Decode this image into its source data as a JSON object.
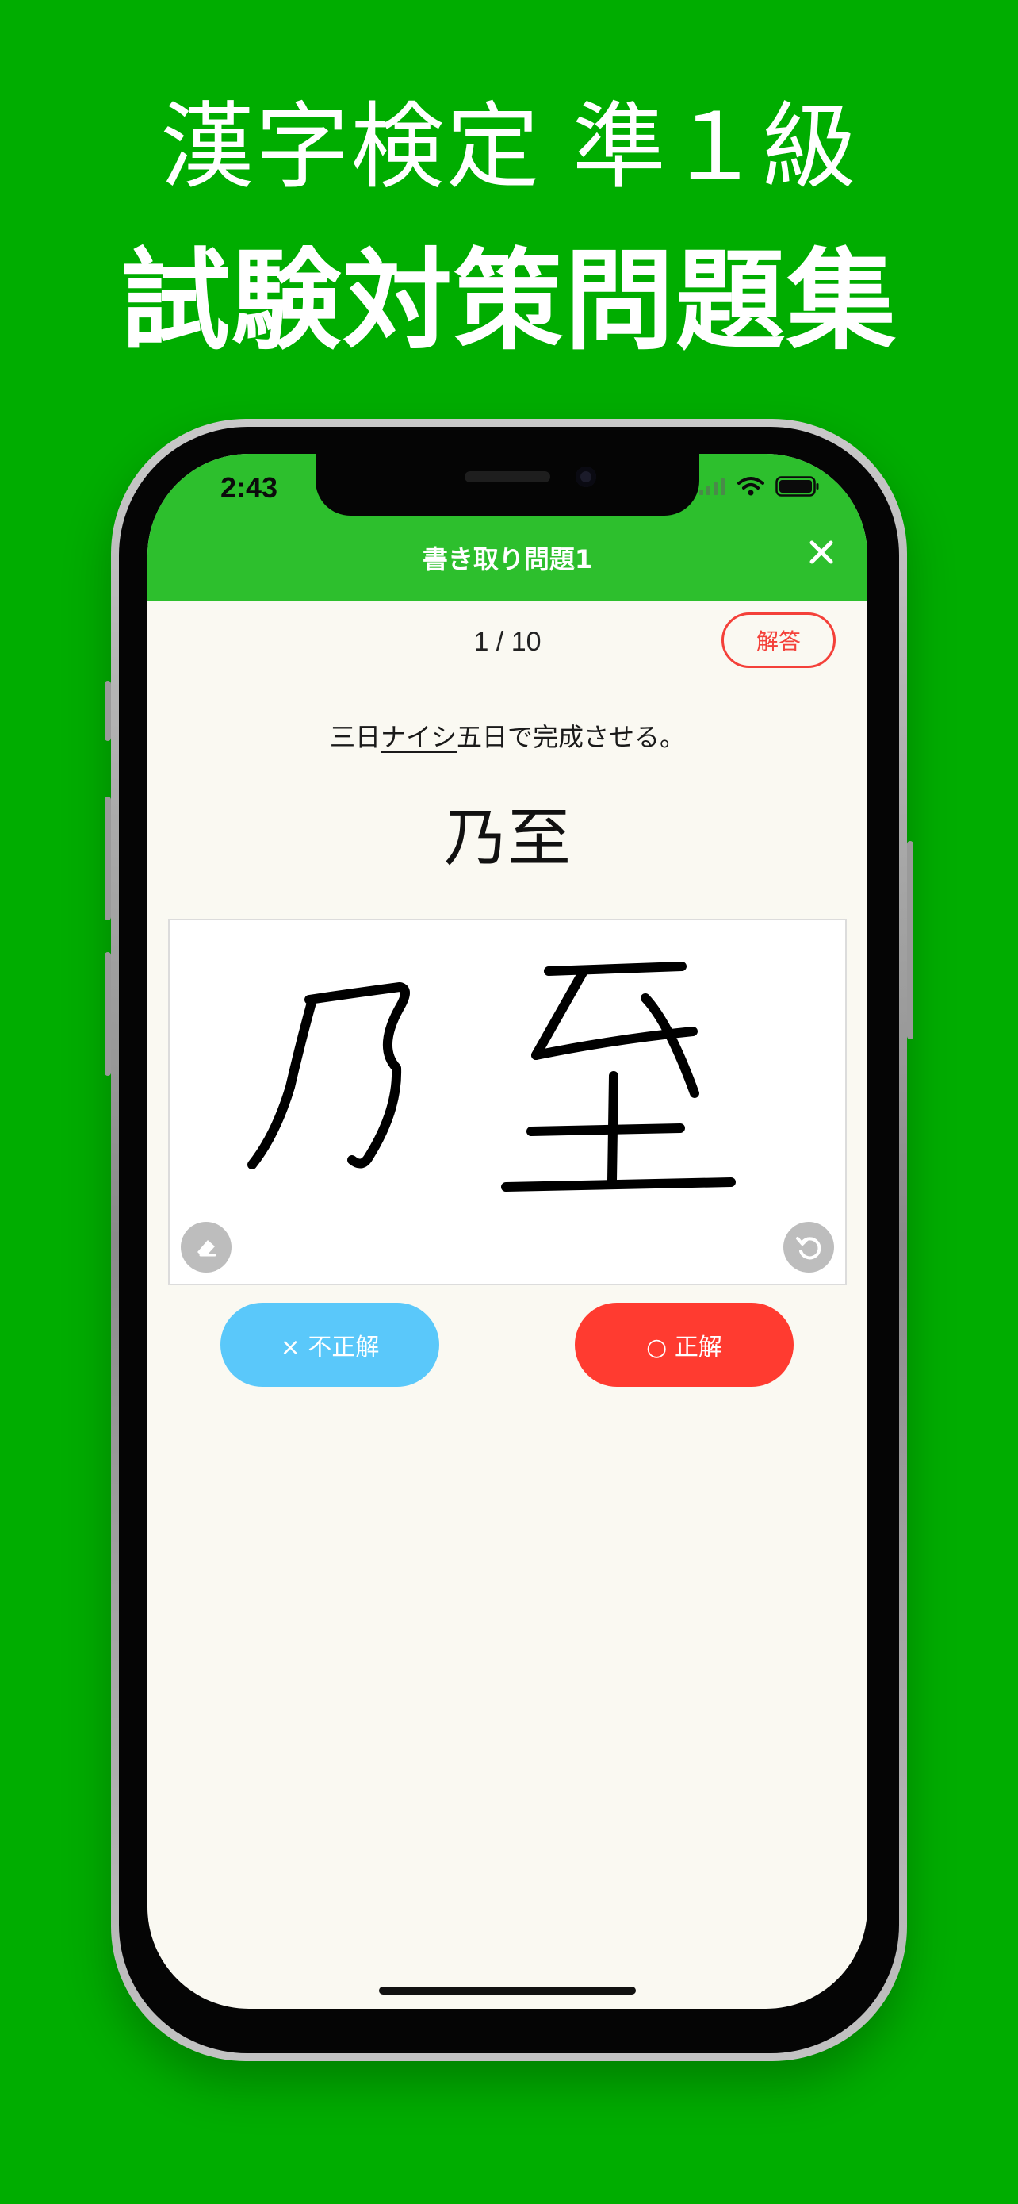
{
  "promo": {
    "line1": "漢字検定 準１級",
    "line2": "試験対策問題集"
  },
  "status_bar": {
    "time": "2:43"
  },
  "nav": {
    "title": "書き取り問題1",
    "close_icon": "close-icon"
  },
  "quiz": {
    "counter": "1 / 10",
    "answer_button": "解答",
    "question_before": "三日",
    "question_underlined": "ナイシ",
    "question_after": "五日で完成させる。",
    "answer_kanji": "乃至"
  },
  "canvas": {
    "eraser_icon": "eraser-icon",
    "undo_icon": "undo-icon"
  },
  "grading": {
    "wrong_label": "× 不正解",
    "correct_label": "○ 正解"
  },
  "colors": {
    "background": "#00AD00",
    "nav_bar": "#2DBF2D",
    "answer_accent": "#F4413A",
    "wrong_button": "#5AC8FA",
    "correct_button": "#FF3B30",
    "screen_bg": "#FAF9F2"
  }
}
